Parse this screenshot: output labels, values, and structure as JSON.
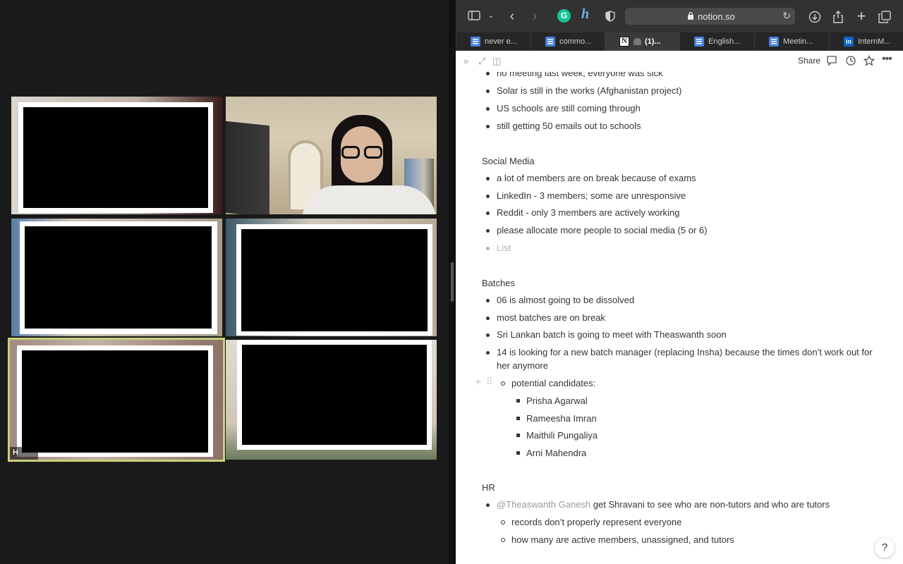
{
  "browser": {
    "url": "notion.so",
    "tabs": [
      {
        "label": "never e...",
        "icon": "docs-icon"
      },
      {
        "label": "commo...",
        "icon": "docs-icon"
      },
      {
        "label": "(1)...",
        "icon": "notion-icon",
        "active": true
      },
      {
        "label": "English...",
        "icon": "docs-icon"
      },
      {
        "label": "Meetin...",
        "icon": "docs-icon"
      },
      {
        "label": "InternM...",
        "icon": "linkedin-icon"
      }
    ],
    "share_label": "Share"
  },
  "video": {
    "highlight_color": "#c8d07a",
    "name_tag": "H"
  },
  "doc": {
    "top_items": [
      "no meeting last week; everyone was sick",
      "Solar is still in the works (Afghanistan project)",
      "US schools are still coming through",
      "still getting 50 emails out to schools"
    ],
    "social": {
      "heading": "Social Media",
      "items": [
        "a lot of members are on break because of exams",
        "LinkedIn - 3 members; some are unresponsive",
        "Reddit - only 3 members are actively working",
        "please allocate more people to social media (5 or 6)"
      ],
      "placeholder": "List"
    },
    "batches": {
      "heading": "Batches",
      "items": [
        "06 is almost going to be dissolved",
        "most batches are on break",
        "Sri Lankan batch is going to meet with Theaswanth soon"
      ],
      "item4_line1": "14 is looking for a new batch manager (replacing Insha) because the times don’t work out for",
      "item4_line2": "her anymore",
      "sub_label": "potential candidates:",
      "candidates": [
        "Prisha Agarwal",
        "Rameesha Imran",
        "Maithili Pungaliya",
        "Arni Mahendra"
      ]
    },
    "hr": {
      "heading": "HR",
      "mention": "@Theaswanth Ganesh",
      "item_rest": " get Shravani to see who are non-tutors and who are tutors",
      "subs": [
        "records don’t properly represent everyone",
        "how many are active members, unassigned, and tutors"
      ]
    }
  },
  "help_label": "?"
}
